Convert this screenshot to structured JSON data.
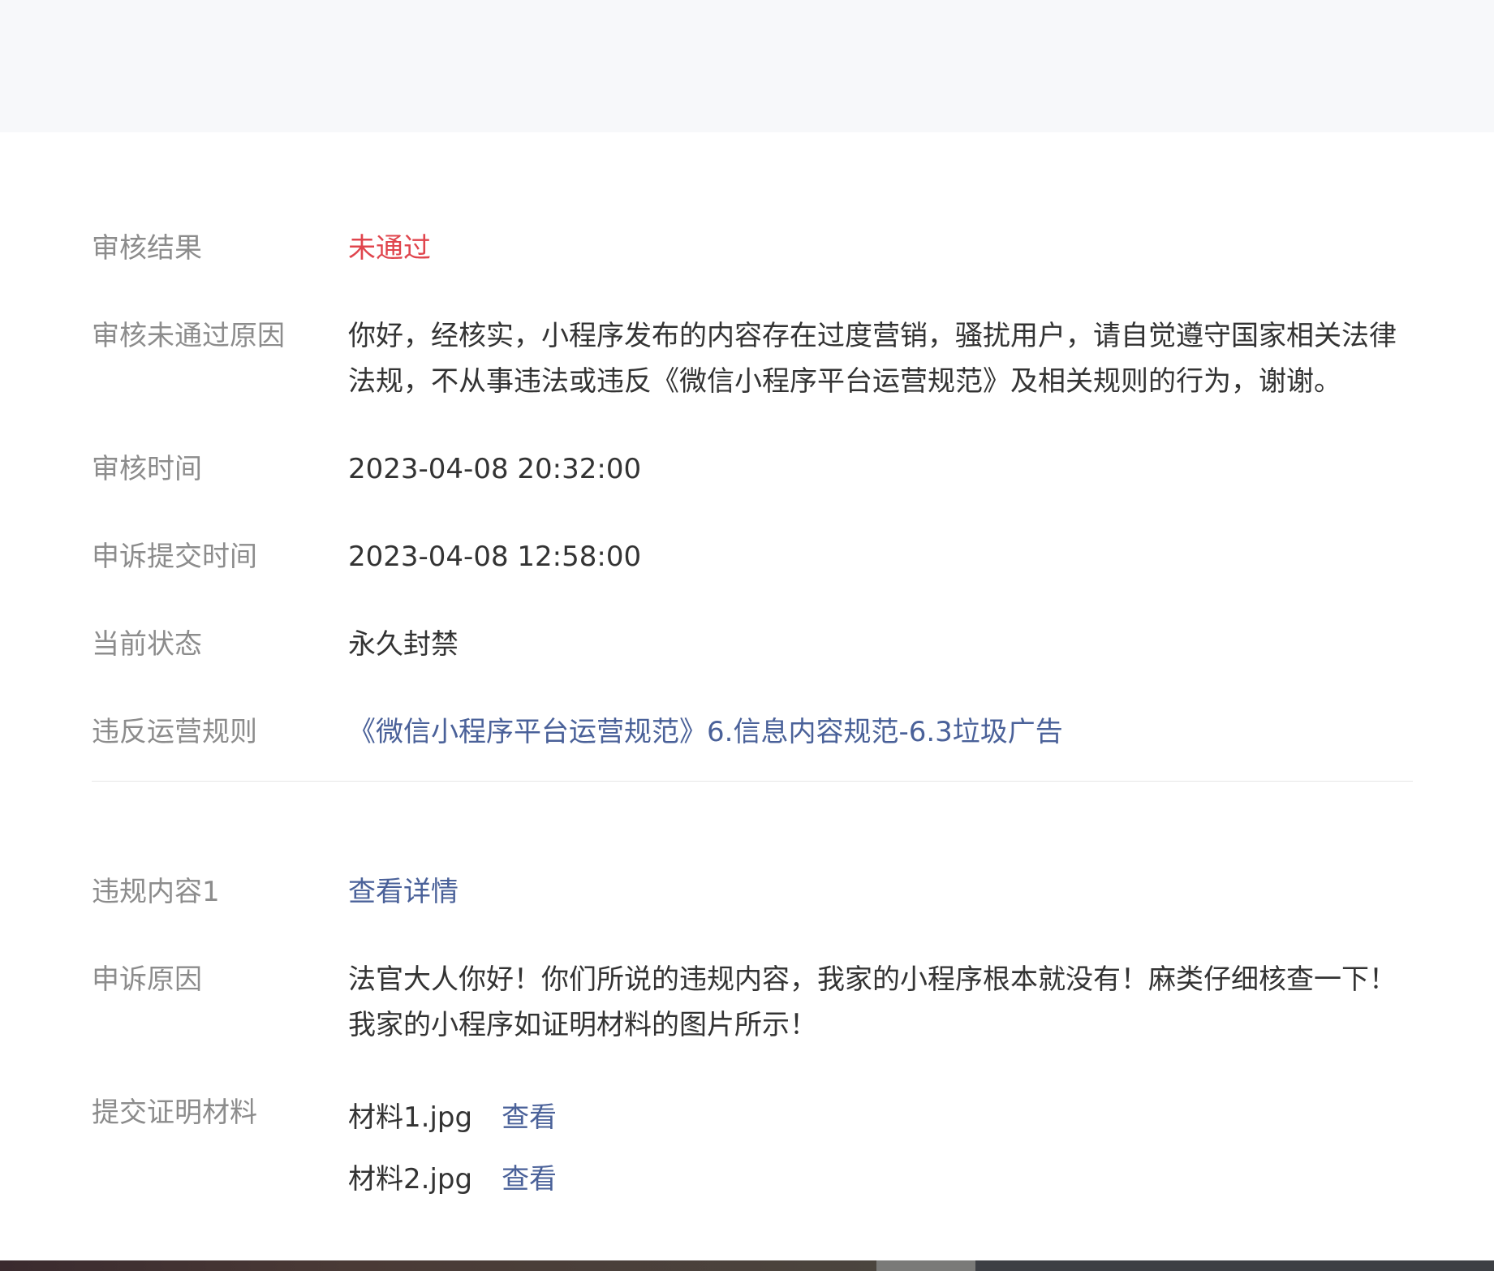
{
  "review_result": {
    "label": "审核结果",
    "value": "未通过"
  },
  "rejection_reason": {
    "label": "审核未通过原因",
    "value": "你好，经核实，小程序发布的内容存在过度营销，骚扰用户，请自觉遵守国家相关法律法规，不从事违法或违反《微信小程序平台运营规范》及相关规则的行为，谢谢。"
  },
  "review_time": {
    "label": "审核时间",
    "value": "2023-04-08 20:32:00"
  },
  "appeal_submit_time": {
    "label": "申诉提交时间",
    "value": "2023-04-08 12:58:00"
  },
  "current_status": {
    "label": "当前状态",
    "value": "永久封禁"
  },
  "violated_rule": {
    "label": "违反运营规则",
    "value": "《微信小程序平台运营规范》6.信息内容规范-6.3垃圾广告"
  },
  "violation_content": {
    "label": "违规内容1",
    "value": "查看详情"
  },
  "appeal_reason": {
    "label": "申诉原因",
    "value": "法官大人你好！你们所说的违规内容，我家的小程序根本就没有！麻类仔细核查一下！我家的小程序如证明材料的图片所示！"
  },
  "evidence": {
    "label": "提交证明材料",
    "files": [
      {
        "name": "材料1.jpg",
        "view_label": "查看"
      },
      {
        "name": "材料2.jpg",
        "view_label": "查看"
      }
    ]
  },
  "colors": {
    "label": "#8c8c8c",
    "text": "#333333",
    "rejected": "#e0454d",
    "link": "#4a6199",
    "top_band": "#f7f8fa"
  }
}
